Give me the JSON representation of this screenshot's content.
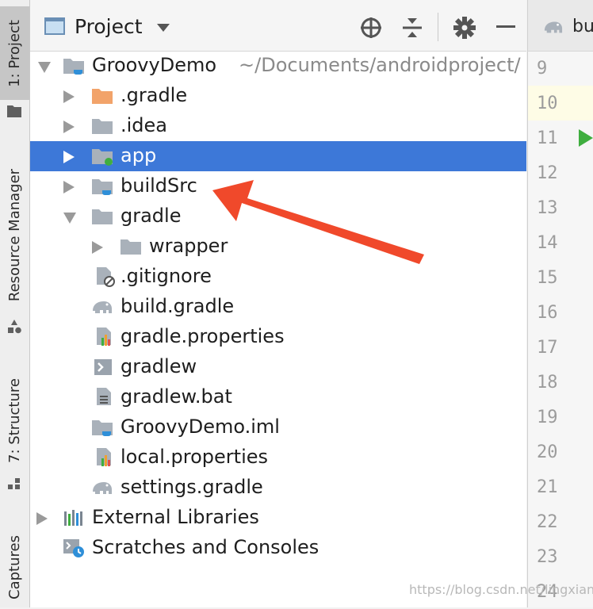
{
  "side_tabs": {
    "project": "1: Project",
    "resource_manager": "Resource Manager",
    "structure": "7: Structure",
    "captures": "Captures"
  },
  "toolbar": {
    "title": "Project"
  },
  "editor": {
    "tab_label": "bu",
    "line_numbers": [
      "9",
      "10",
      "11",
      "12",
      "13",
      "14",
      "15",
      "16",
      "17",
      "18",
      "19",
      "20",
      "21",
      "22",
      "23",
      "24"
    ]
  },
  "tree": {
    "items": [
      {
        "label": "GroovyDemo",
        "path": "~/Documents/androidproject/"
      },
      {
        "label": ".gradle"
      },
      {
        "label": ".idea"
      },
      {
        "label": "app"
      },
      {
        "label": "buildSrc"
      },
      {
        "label": "gradle"
      },
      {
        "label": "wrapper"
      },
      {
        "label": ".gitignore"
      },
      {
        "label": "build.gradle"
      },
      {
        "label": "gradle.properties"
      },
      {
        "label": "gradlew"
      },
      {
        "label": "gradlew.bat"
      },
      {
        "label": "GroovyDemo.iml"
      },
      {
        "label": "local.properties"
      },
      {
        "label": "settings.gradle"
      },
      {
        "label": "External Libraries"
      },
      {
        "label": "Scratches and Consoles"
      }
    ]
  },
  "watermark": "https://blog.csdn.net/lingxianglin",
  "colors": {
    "selection": "#3d78d8",
    "annotation_arrow": "#f0492b",
    "run_marker": "#3fae3f"
  }
}
